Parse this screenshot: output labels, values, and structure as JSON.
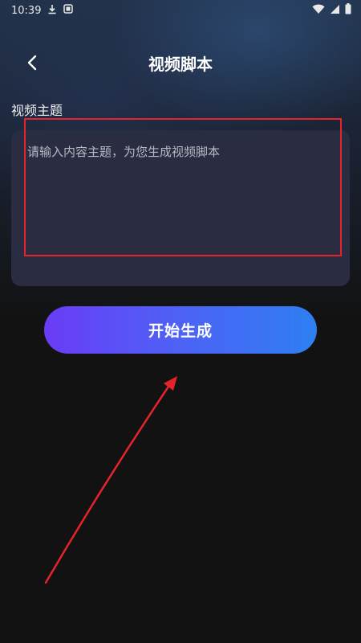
{
  "status_bar": {
    "time": "10:39",
    "left_icons": [
      "download-icon",
      "app-notification-icon"
    ],
    "right_icons": [
      "wifi-icon",
      "cellular-signal-icon",
      "battery-icon"
    ]
  },
  "header": {
    "title": "视频脚本",
    "back_icon": "chevron-left-icon"
  },
  "form": {
    "section_label": "视频主题",
    "topic_input": {
      "placeholder": "请输入内容主题，为您生成视频脚本",
      "value": ""
    }
  },
  "actions": {
    "generate_label": "开始生成"
  },
  "colors": {
    "background": "#121212",
    "input_background": "#2a2d42",
    "button_gradient_start": "#6a3cf6",
    "button_gradient_end": "#2e7ff2",
    "annotation_red": "#e4242b"
  },
  "annotations": {
    "highlight": "red-rectangle-around-topic-input",
    "arrow": "red-arrow-pointing-to-generate-button"
  }
}
